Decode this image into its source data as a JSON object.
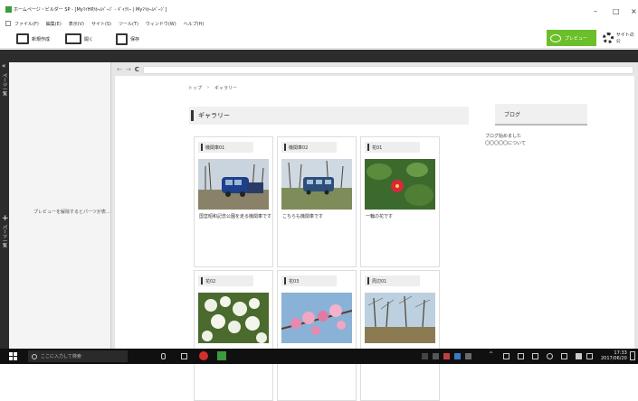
{
  "window": {
    "title": "ホームページ・ビルダー SP - [MyﾏｲHP/ﾎｰﾑﾍﾟｰｼﾞ - ｷﾞｬﾗﾘｰ | Myﾏｲﾎｰﾑﾍﾟｰｼﾞ]",
    "minimize": "–",
    "maximize": "□",
    "close": "×"
  },
  "menu": [
    "ファイル(F)",
    "編集(E)",
    "表示(V)",
    "サイト(S)",
    "ツール(T)",
    "ウィンドウ(W)",
    "ヘルプ(H)"
  ],
  "toolbar": {
    "new_label": "新規作成",
    "open_label": "開く",
    "save_label": "保存",
    "preview_label": "プレビュー",
    "site_label": "サイトの公"
  },
  "sidebar": {
    "label_top": "ページ一覧",
    "label_bottom": "パーツ一覧",
    "parts_hint": "プレビューを解除するとパーツが表..."
  },
  "browser": {
    "url": ""
  },
  "page": {
    "breadcrumb": [
      "トップ",
      "›",
      "ギャラリー"
    ],
    "gallery_title": "ギャラリー",
    "blog_title": "ブログ",
    "blog_items": [
      "ブログ始めました",
      "〇〇〇〇〇について"
    ],
    "cards": [
      {
        "caption": "機関車01",
        "description": "国営昭和記念公園を走る機関車です",
        "image": "train-photo"
      },
      {
        "caption": "機関車02",
        "description": "こちらも機関車です",
        "image": "train-photo-2"
      },
      {
        "caption": "花01",
        "description": "一輪の花です",
        "image": "red-flower-photo"
      },
      {
        "caption": "花02",
        "description": "",
        "image": "white-flowers-photo"
      },
      {
        "caption": "花03",
        "description": "",
        "image": "pink-blossom-photo"
      },
      {
        "caption": "周辺01",
        "description": "",
        "image": "park-trees-photo"
      }
    ]
  },
  "taskbar": {
    "search_placeholder": "ここに入力して検索",
    "time": "17:33",
    "date": "2017/06/20"
  },
  "colors": {
    "accent_green": "#6bbf2a",
    "dark_panel": "#2c2c2c",
    "taskbar": "#101010"
  }
}
